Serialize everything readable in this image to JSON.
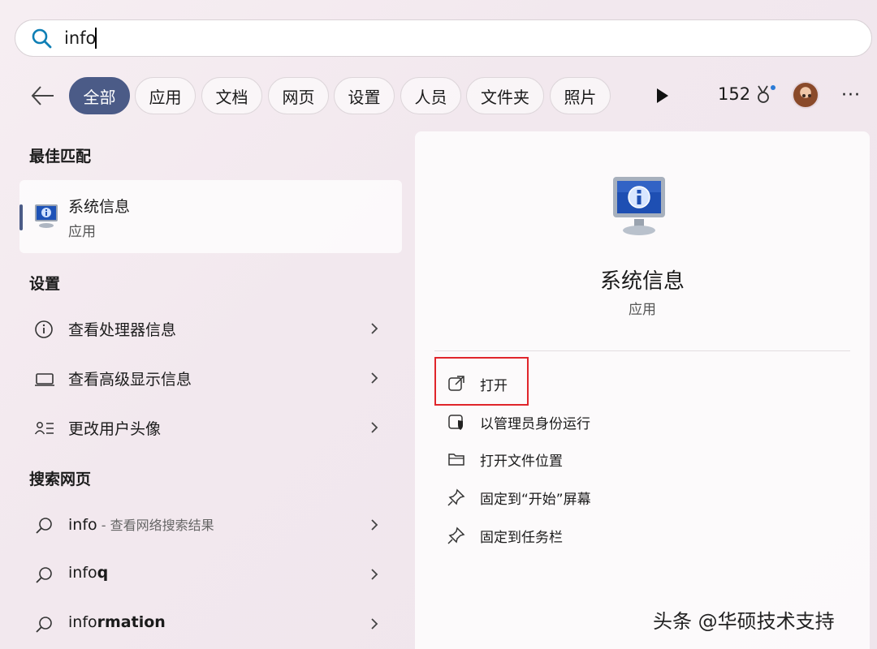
{
  "search": {
    "query": "info"
  },
  "filters": [
    "全部",
    "应用",
    "文档",
    "网页",
    "设置",
    "人员",
    "文件夹",
    "照片"
  ],
  "points": "152",
  "more": "···",
  "best_match": {
    "title": "最佳匹配",
    "name": "系统信息",
    "type": "应用"
  },
  "settings": {
    "title": "设置",
    "items": [
      "查看处理器信息",
      "查看高级显示信息",
      "更改用户头像"
    ]
  },
  "web": {
    "title": "搜索网页",
    "item1_main": "info",
    "item1_suffix": " - 查看网络搜索结果",
    "item2_prefix": "info",
    "item2_bold": "q",
    "item3_prefix": "info",
    "item3_bold": "rmation"
  },
  "detail": {
    "name": "系统信息",
    "type": "应用",
    "actions": [
      "打开",
      "以管理员身份运行",
      "打开文件位置",
      "固定到“开始”屏幕",
      "固定到任务栏"
    ]
  },
  "watermark": "头条 @华硕技术支持",
  "colors": {
    "accent": "#4b5b87",
    "highlight": "#e0252b"
  }
}
